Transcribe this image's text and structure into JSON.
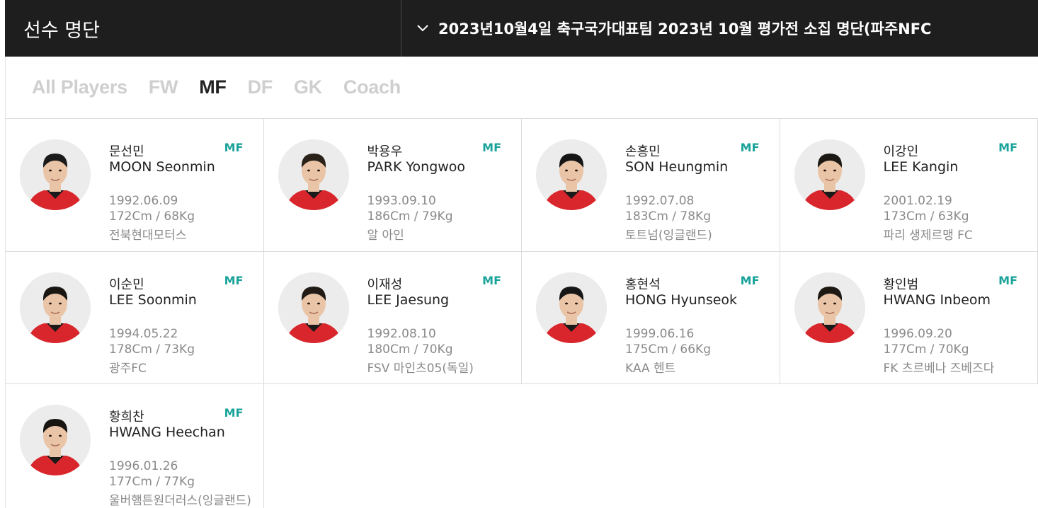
{
  "header": {
    "title": "선수 명단",
    "selected_roster": "2023년10월4일 축구국가대표팀 2023년 10월 평가전 소집 명단(파주NFC"
  },
  "tabs": [
    {
      "label": "All Players",
      "active": false
    },
    {
      "label": "FW",
      "active": false
    },
    {
      "label": "MF",
      "active": true
    },
    {
      "label": "DF",
      "active": false
    },
    {
      "label": "GK",
      "active": false
    },
    {
      "label": "Coach",
      "active": false
    }
  ],
  "colors": {
    "header_bg": "#1e1e1e",
    "position_accent": "#1aa39a",
    "kit_red": "#d9262c"
  },
  "players": [
    {
      "name_kr": "문선민",
      "name_en": "MOON Seonmin",
      "position": "MF",
      "birth": "1992.06.09",
      "body": "172Cm / 68Kg",
      "club": "전북현대모터스"
    },
    {
      "name_kr": "박용우",
      "name_en": "PARK Yongwoo",
      "position": "MF",
      "birth": "1993.09.10",
      "body": "186Cm / 79Kg",
      "club": "알 아인"
    },
    {
      "name_kr": "손흥민",
      "name_en": "SON Heungmin",
      "position": "MF",
      "birth": "1992.07.08",
      "body": "183Cm / 78Kg",
      "club": "토트넘(잉글랜드)"
    },
    {
      "name_kr": "이강인",
      "name_en": "LEE Kangin",
      "position": "MF",
      "birth": "2001.02.19",
      "body": "173Cm / 63Kg",
      "club": "파리 생제르맹 FC"
    },
    {
      "name_kr": "이순민",
      "name_en": "LEE Soonmin",
      "position": "MF",
      "birth": "1994.05.22",
      "body": "178Cm / 73Kg",
      "club": "광주FC"
    },
    {
      "name_kr": "이재성",
      "name_en": "LEE Jaesung",
      "position": "MF",
      "birth": "1992.08.10",
      "body": "180Cm / 70Kg",
      "club": "FSV 마인츠05(독일)"
    },
    {
      "name_kr": "홍현석",
      "name_en": "HONG Hyunseok",
      "position": "MF",
      "birth": "1999.06.16",
      "body": "175Cm / 66Kg",
      "club": "KAA 헨트"
    },
    {
      "name_kr": "황인범",
      "name_en": "HWANG Inbeom",
      "position": "MF",
      "birth": "1996.09.20",
      "body": "177Cm / 70Kg",
      "club": "FK 츠르베나 즈베즈다"
    },
    {
      "name_kr": "황희찬",
      "name_en": "HWANG Heechan",
      "position": "MF",
      "birth": "1996.01.26",
      "body": "177Cm / 77Kg",
      "club": "울버햄튼원더러스(잉글랜드)"
    }
  ]
}
